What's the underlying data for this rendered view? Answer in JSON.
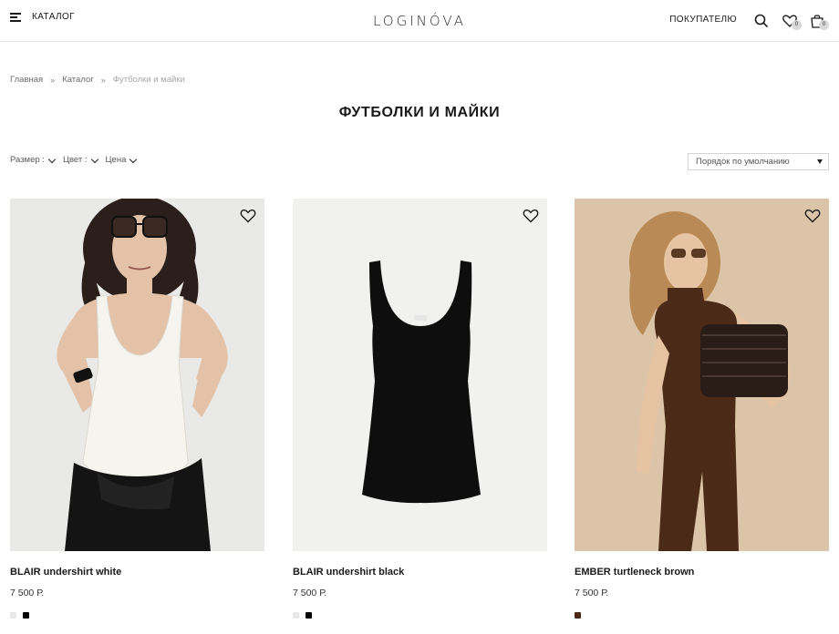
{
  "header": {
    "menu_label": "КАТАЛОГ",
    "logo": "LOGINÓVA",
    "buyer_link": "ПОКУПАТЕЛЮ",
    "wishlist_count": "0",
    "cart_count": "0"
  },
  "breadcrumb": {
    "items": [
      "Главная",
      "Каталог",
      "Футболки и майки"
    ],
    "separator": "»"
  },
  "page_title": "ФУТБОЛКИ И МАЙКИ",
  "filters": {
    "size": "Размер :",
    "color": "Цвет :",
    "price": "Цена"
  },
  "sort": {
    "selected": "Порядок по умолчанию"
  },
  "products": [
    {
      "name": "BLAIR undershirt white",
      "price": "7 500 Р.",
      "swatches": [
        "#e8e8e8",
        "#000000"
      ]
    },
    {
      "name": "BLAIR undershirt black",
      "price": "7 500 Р.",
      "swatches": [
        "#e8e8e8",
        "#000000"
      ]
    },
    {
      "name": "EMBER turtleneck brown",
      "price": "7 500 Р.",
      "swatches": [
        "#4a2a18"
      ]
    }
  ],
  "colors": {
    "text": "#1a1a1a",
    "muted": "#6c6c6c",
    "border": "#e6e6e6"
  }
}
